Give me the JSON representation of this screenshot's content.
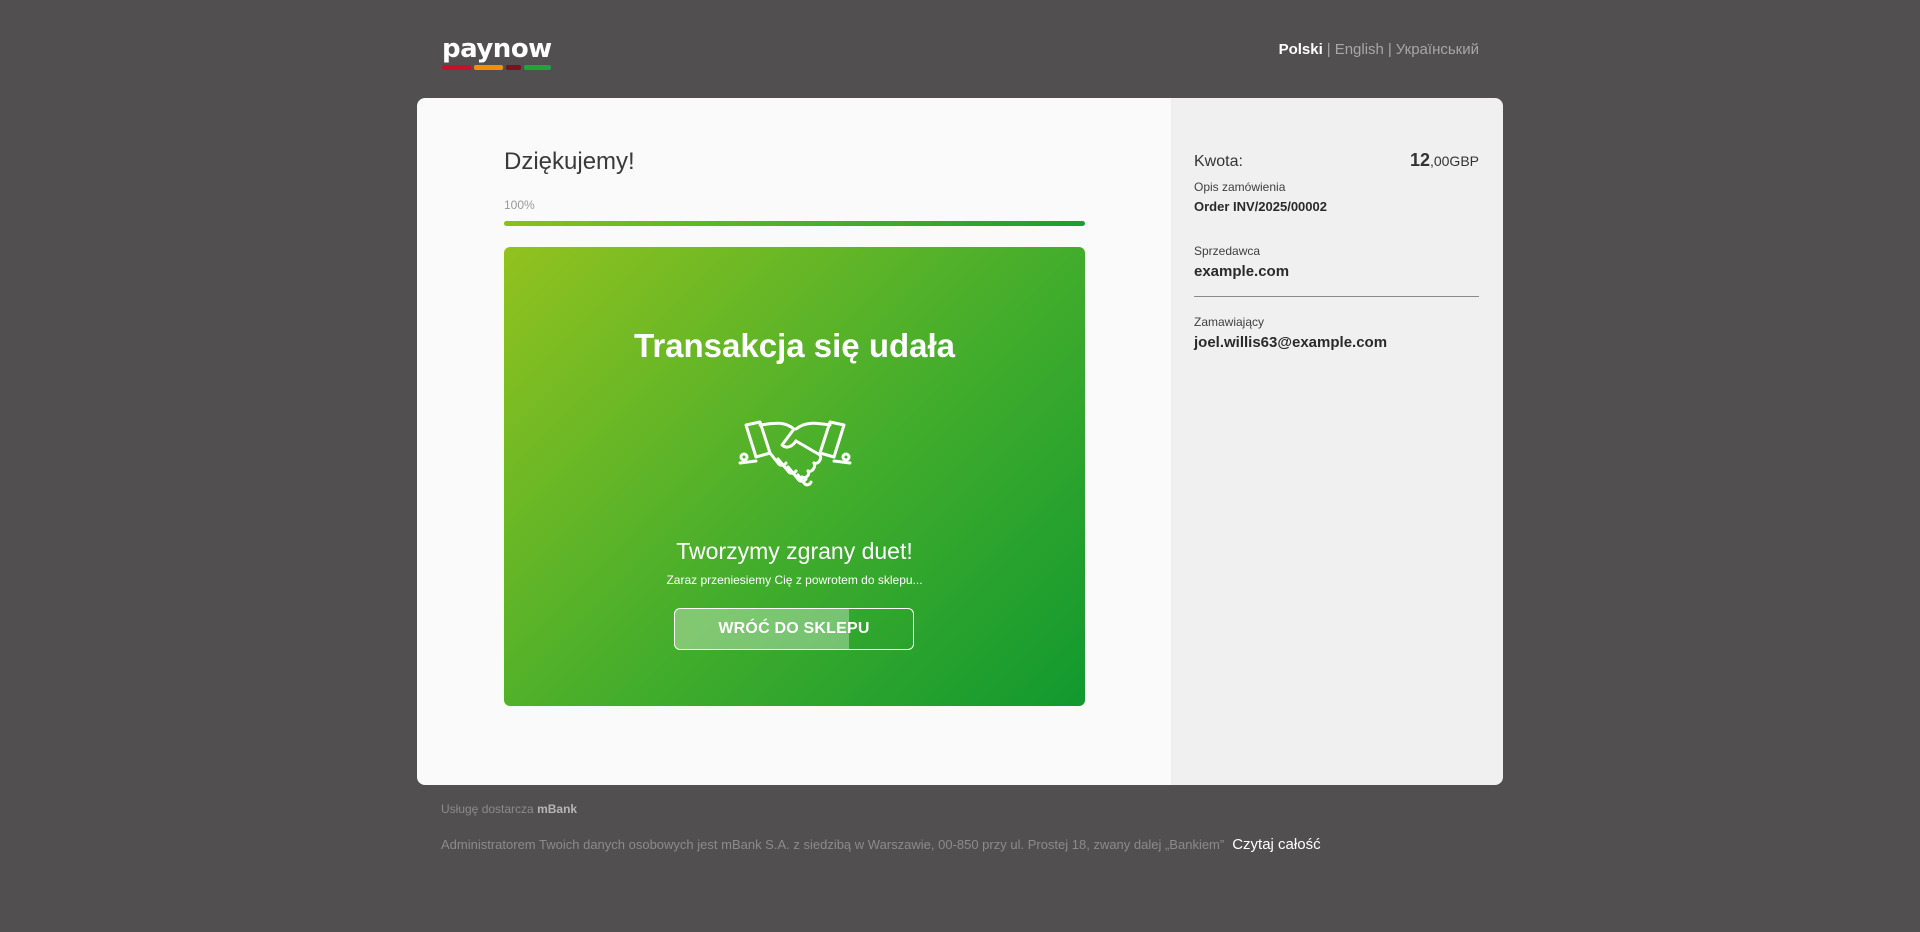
{
  "header": {
    "logo_text": "paynow",
    "languages": [
      {
        "label": "Polski",
        "active": true
      },
      {
        "label": "English",
        "active": false
      },
      {
        "label": "Український",
        "active": false
      }
    ],
    "separator": "|"
  },
  "main": {
    "title": "Dziękujemy!",
    "progress": {
      "label": "100%",
      "value": 1.0
    },
    "success": {
      "title": "Transakcja się udała",
      "icon": "handshake-icon",
      "subtitle": "Tworzymy zgrany duet!",
      "redirect_text": "Zaraz przeniesiemy Cię z powrotem do sklepu...",
      "button_label": "WRÓĆ DO SKLEPU",
      "countdown_progress": 0.73
    }
  },
  "summary": {
    "amount_label": "Kwota:",
    "amount_integer": "12",
    "amount_rest": ",00GBP",
    "order_description_label": "Opis zamówienia",
    "order_description_value": "Order INV/2025/00002",
    "seller_label": "Sprzedawca",
    "seller_value": "example.com",
    "orderer_label": "Zamawiający",
    "orderer_value": "joel.willis63@example.com"
  },
  "footer": {
    "provider_text": "Usługę dostarcza",
    "provider_bank": "mBank",
    "admin_text": "Administratorem Twoich danych osobowych jest mBank S.A. z siedzibą w Warszawie, 00-850 przy ul. Prostej 18, zwany dalej „Bankiem”",
    "read_more": "Czytaj całość"
  },
  "colors": {
    "background": "#524f50",
    "success_gradient_start": "#92c21f",
    "success_gradient_end": "#11992f",
    "logo_bar": [
      "#c8102e",
      "#f29100",
      "#7a1020",
      "#1fa33a"
    ]
  }
}
